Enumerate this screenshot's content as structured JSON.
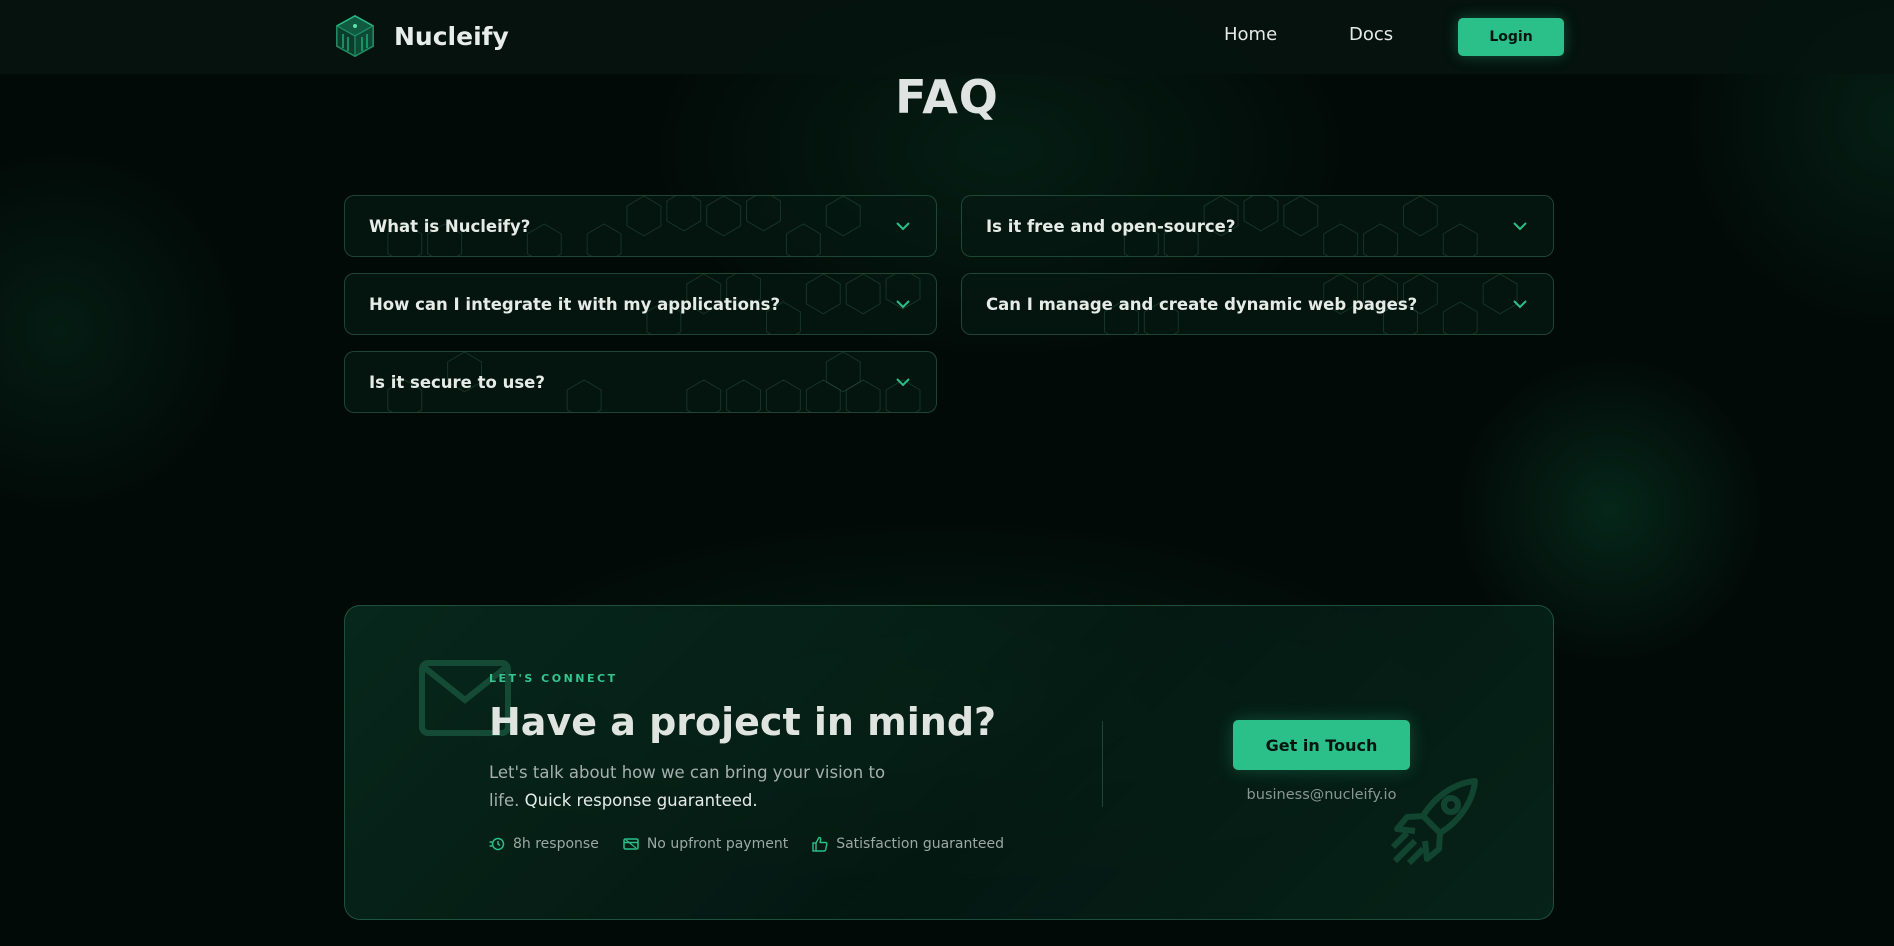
{
  "header": {
    "brand_name": "Nucleify",
    "logo_icon": "cube-logo-icon",
    "nav": [
      {
        "label": "Home"
      },
      {
        "label": "Docs"
      }
    ],
    "login_label": "Login"
  },
  "faq": {
    "title": "FAQ",
    "items": [
      {
        "question": "What is Nucleify?"
      },
      {
        "question": "Is it free and open-source?"
      },
      {
        "question": "How can I integrate it with my applications?"
      },
      {
        "question": "Can I manage and create dynamic web pages?"
      },
      {
        "question": "Is it secure to use?"
      }
    ]
  },
  "contact": {
    "eyebrow": "LET'S CONNECT",
    "headline": "Have a project in mind?",
    "description": "Let's talk about how we can bring your vision to life.",
    "description_emphasis": "Quick response guaranteed.",
    "perks": [
      {
        "icon": "clock-icon",
        "label": "8h response"
      },
      {
        "icon": "card-icon",
        "label": "No upfront payment"
      },
      {
        "icon": "thumbs-up-icon",
        "label": "Satisfaction guaranteed"
      }
    ],
    "cta_label": "Get in Touch",
    "email": "business@nucleify.io"
  },
  "colors": {
    "accent": "#2bbf8a",
    "background": "#020a07",
    "card_border": "#3c8264"
  }
}
